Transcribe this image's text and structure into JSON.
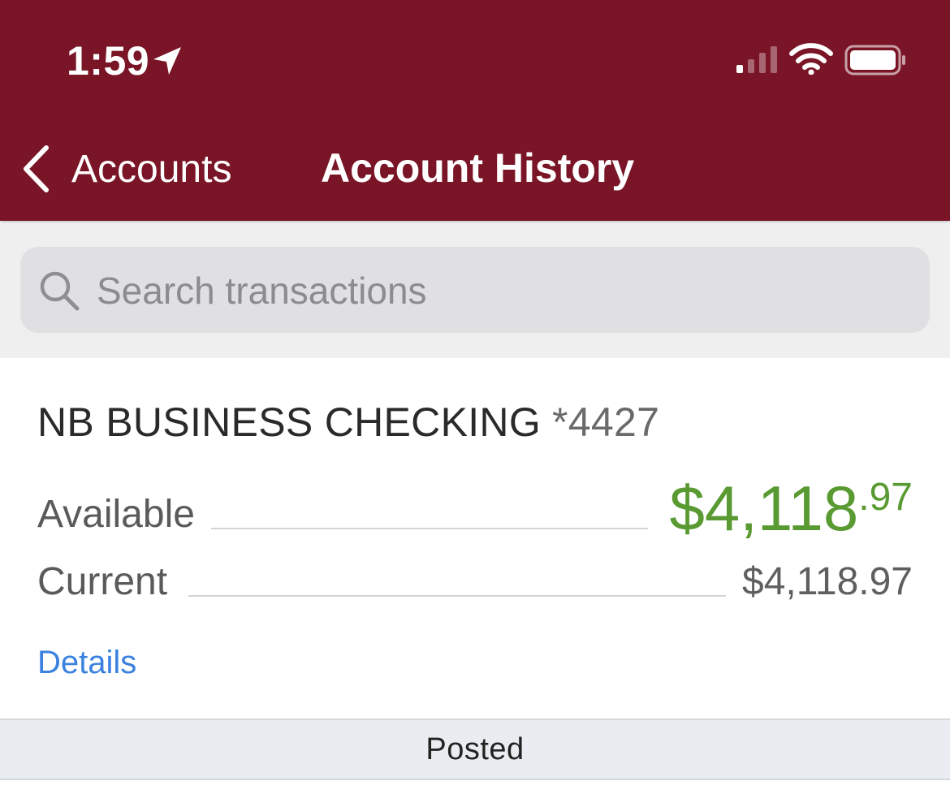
{
  "status_bar": {
    "time": "1:59",
    "icons": [
      "location-arrow-icon",
      "cellular-signal-icon",
      "wifi-icon",
      "battery-icon"
    ]
  },
  "nav": {
    "back_label": "Accounts",
    "title": "Account History"
  },
  "search": {
    "placeholder": "Search transactions",
    "value": ""
  },
  "account": {
    "name": "NB BUSINESS CHECKING",
    "number": "*4427",
    "available_label": "Available",
    "available_dollars": "$4,118",
    "available_cents": ".97",
    "current_label": "Current",
    "current_amount": "$4,118.97",
    "details_link": "Details"
  },
  "section": {
    "posted_label": "Posted"
  },
  "colors": {
    "brand": "#791526",
    "available_green": "#5a9a32",
    "link_blue": "#3b82e0"
  }
}
